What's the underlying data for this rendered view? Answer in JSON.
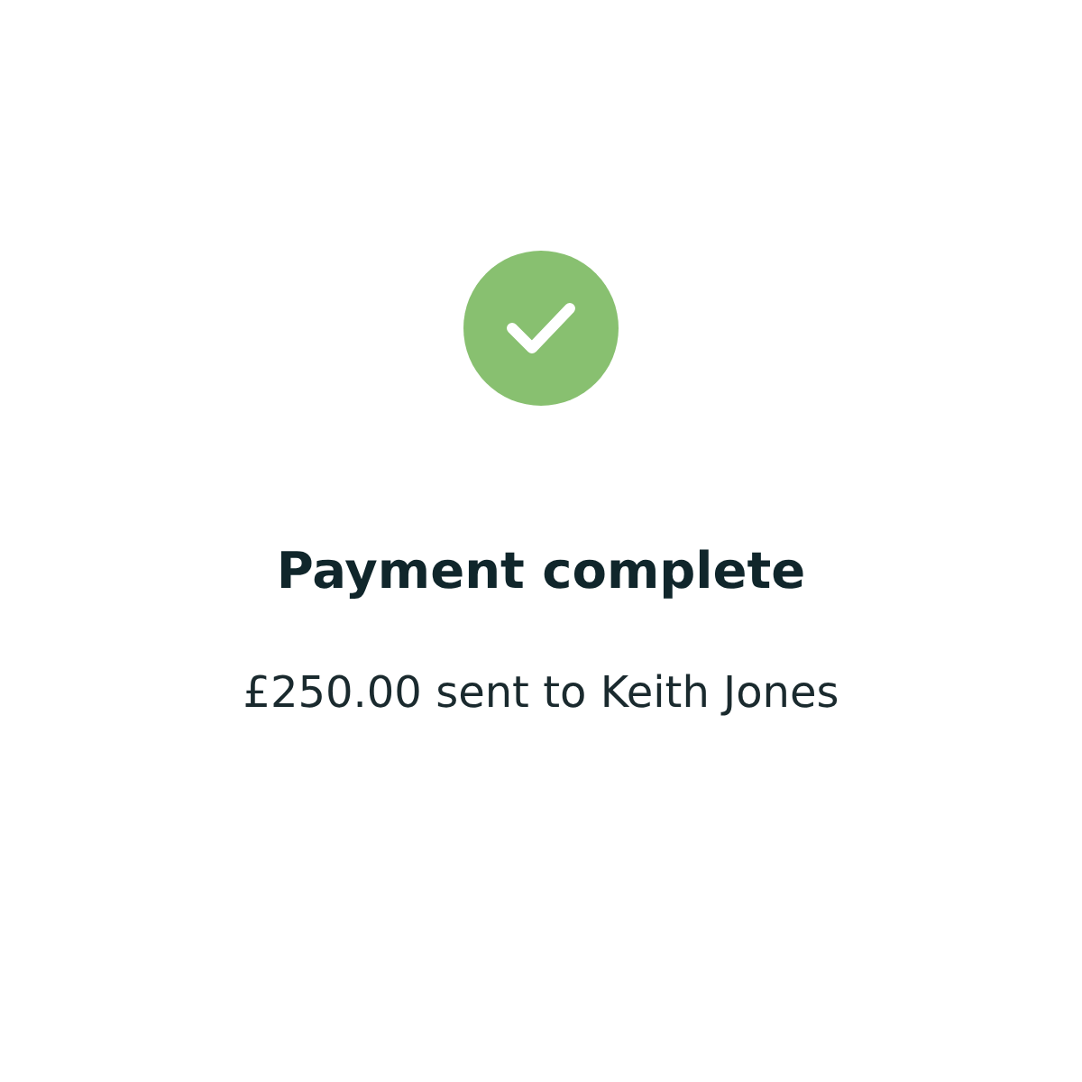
{
  "status": {
    "kind": "success",
    "title": "Payment complete",
    "message": "£250.00 sent to Keith Jones"
  }
}
